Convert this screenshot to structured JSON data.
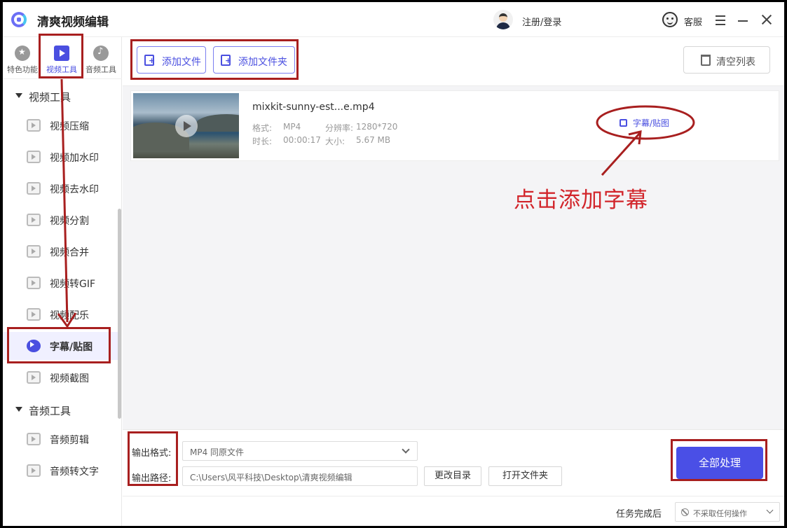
{
  "app": {
    "title": "清爽视频编辑",
    "login": "注册/登录",
    "service": "客服"
  },
  "top_tabs": [
    {
      "label": "特色功能",
      "icon": "star-icon"
    },
    {
      "label": "视频工具",
      "icon": "video-icon",
      "active": true
    },
    {
      "label": "音频工具",
      "icon": "music-icon"
    }
  ],
  "sidebar": {
    "video_group": "视频工具",
    "video_items": [
      "视频压缩",
      "视频加水印",
      "视频去水印",
      "视频分割",
      "视频合并",
      "视频转GIF",
      "视频配乐",
      "字幕/贴图",
      "视频截图"
    ],
    "active_item": "字幕/贴图",
    "audio_group": "音频工具",
    "audio_items": [
      "音频剪辑",
      "音频转文字"
    ]
  },
  "toolbar": {
    "add_file": "添加文件",
    "add_folder": "添加文件夹",
    "clear_list": "清空列表"
  },
  "file": {
    "name": "mixkit-sunny-est...e.mp4",
    "format_label": "格式:",
    "format": "MP4",
    "resolution_label": "分辨率:",
    "resolution": "1280*720",
    "duration_label": "时长:",
    "duration": "00:00:17",
    "size_label": "大小:",
    "size": "5.67 MB",
    "action": "字幕/贴图"
  },
  "annotation": "点击添加字幕",
  "output": {
    "format_label": "输出格式:",
    "format_value": "MP4  同原文件",
    "path_label": "输出路径:",
    "path_value": "C:\\Users\\风平科技\\Desktop\\清爽视频编辑",
    "change_dir": "更改目录",
    "open_folder": "打开文件夹",
    "process_all": "全部处理"
  },
  "status": {
    "after_label": "任务完成后",
    "after_value": "不采取任何操作"
  },
  "colors": {
    "accent": "#4a4fe0",
    "annotation": "#a81f1f"
  }
}
